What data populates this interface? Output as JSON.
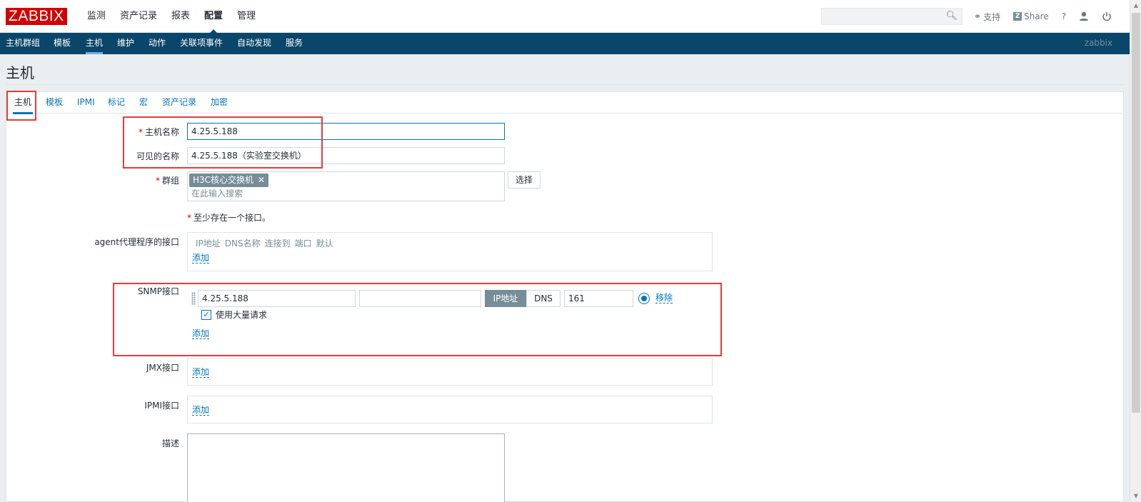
{
  "header": {
    "logo": "ZABBIX",
    "menu": [
      "监测",
      "资产记录",
      "报表",
      "配置",
      "管理"
    ],
    "selected_menu": "配置",
    "search_placeholder": "",
    "links": {
      "support": "支持",
      "share": "Share",
      "help": "?"
    }
  },
  "submenu": {
    "items": [
      "主机群组",
      "模板",
      "主机",
      "维护",
      "动作",
      "关联项事件",
      "自动发现",
      "服务"
    ],
    "selected": "主机",
    "user": "zabbix"
  },
  "page": {
    "title": "主机"
  },
  "tabs": [
    "主机",
    "模板",
    "IPMI",
    "标记",
    "宏",
    "资产记录",
    "加密"
  ],
  "form": {
    "host_name": {
      "label": "主机名称",
      "required": "*",
      "value": "4.25.5.188"
    },
    "visible_name": {
      "label": "可见的名称",
      "value": "4.25.5.188（实验室交换机）"
    },
    "groups": {
      "label": "群组",
      "required": "*",
      "tag": "H3C核心交换机",
      "tag_remove": "✕",
      "placeholder": "在此输入搜索",
      "select_button": "选择"
    },
    "interface_notice": {
      "required": "*",
      "text": "至少存在一个接口。"
    },
    "agent": {
      "label": "agent代理程序的接口",
      "columns": [
        "IP地址",
        "DNS名称",
        "连接到",
        "端口",
        "默认"
      ],
      "add": "添加"
    },
    "snmp": {
      "label": "SNMP接口",
      "ip": "4.25.5.188",
      "dns": "",
      "connect_ip": "IP地址",
      "connect_dns": "DNS",
      "port": "161",
      "remove": "移除",
      "bulk_label": "使用大量请求",
      "bulk_checked": true,
      "add": "添加"
    },
    "jmx": {
      "label": "JMX接口",
      "add": "添加"
    },
    "ipmi": {
      "label": "IPMI接口",
      "add": "添加"
    },
    "description": {
      "label": "描述",
      "value": ""
    }
  },
  "colors": {
    "brand": "#d40000",
    "nav": "#0a466a",
    "link": "#0275b8",
    "highlight_box": "#e83a3a"
  }
}
